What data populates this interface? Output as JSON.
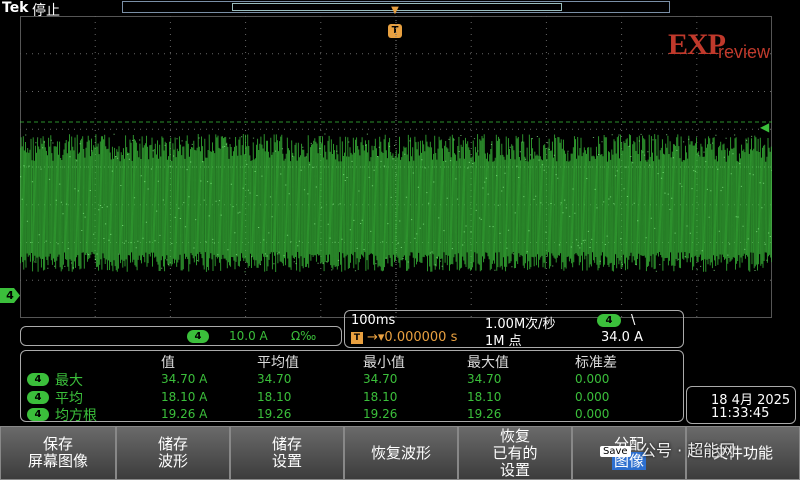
{
  "top": {
    "brand": "Tek",
    "status": "停止"
  },
  "watermark_logo": {
    "exp": "EXP",
    "review": "review"
  },
  "channel": {
    "badge": "4",
    "scale": "10.0 A",
    "coupling": "Ω‰"
  },
  "marker": {
    "ch4": "4",
    "trigger": "T"
  },
  "horizontal": {
    "timebase": "100ms",
    "delay": "→▾0.000000 s",
    "trig_icon": "T",
    "sample_rate": "1.00M次/秒",
    "record_length": "1M 点",
    "trig_channel": "4",
    "trig_slope": "\\",
    "trig_level": "34.0 A"
  },
  "measurements": {
    "headers": [
      "值",
      "平均值",
      "最小值",
      "最大值",
      "标准差"
    ],
    "rows": [
      {
        "badge": "4",
        "label": "最大",
        "values": [
          "34.70 A",
          "34.70",
          "34.70",
          "34.70",
          "0.000"
        ]
      },
      {
        "badge": "4",
        "label": "平均",
        "values": [
          "18.10 A",
          "18.10",
          "18.10",
          "18.10",
          "0.000"
        ]
      },
      {
        "badge": "4",
        "label": "均方根",
        "values": [
          "19.26 A",
          "19.26",
          "19.26",
          "19.26",
          "0.000"
        ]
      }
    ]
  },
  "datetime": {
    "date": "18 4月 2025",
    "time": "11:33:45"
  },
  "menu": {
    "b1": [
      "保存",
      "屏幕图像"
    ],
    "b2": [
      "储存",
      "波形"
    ],
    "b3": [
      "储存",
      "设置"
    ],
    "b4": [
      "恢复波形"
    ],
    "b5": [
      "恢复",
      "已有的",
      "设置"
    ],
    "b6": [
      "分配",
      "图像"
    ],
    "b7": [
      "文件功能"
    ],
    "save_tag": "Save"
  },
  "overlay": {
    "watermark": "公号 · 超能网"
  },
  "colors": {
    "trace": "#3bbf3b",
    "trigger": "#e8a040",
    "accent": "#2d6fcf"
  }
}
